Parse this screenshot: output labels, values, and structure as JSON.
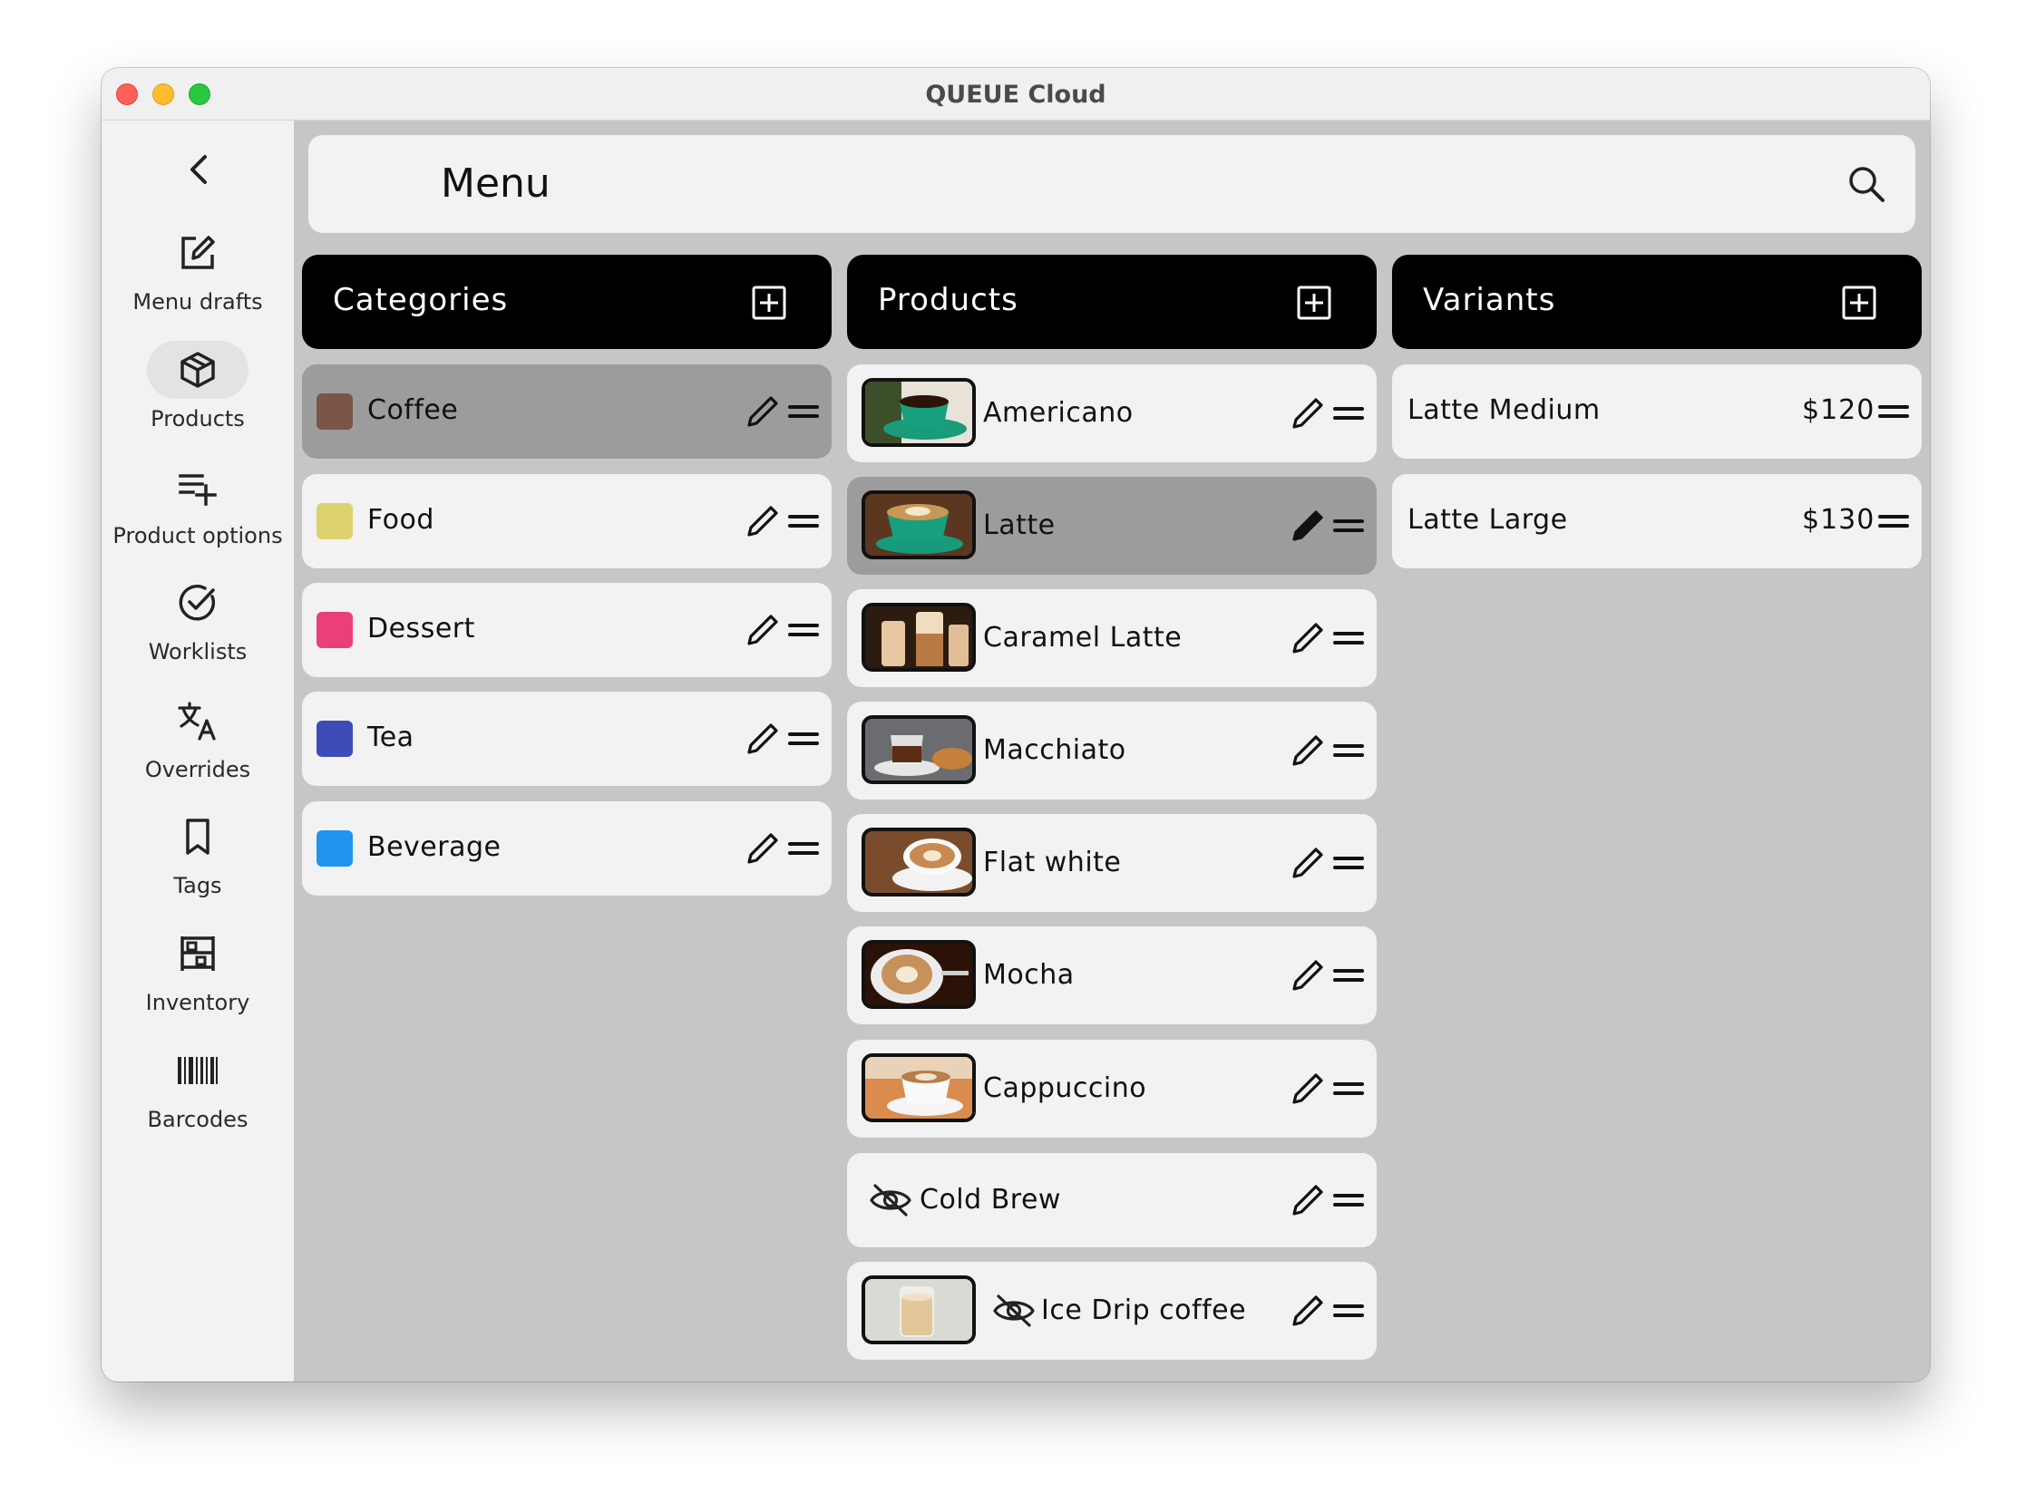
{
  "window": {
    "title": "QUEUE Cloud"
  },
  "sidebar": {
    "items": [
      {
        "label": "Menu drafts",
        "icon": "edit-square-icon"
      },
      {
        "label": "Products",
        "icon": "box-icon",
        "active": true
      },
      {
        "label": "Product options",
        "icon": "list-add-icon"
      },
      {
        "label": "Worklists",
        "icon": "check-circle-icon"
      },
      {
        "label": "Overrides",
        "icon": "translate-icon"
      },
      {
        "label": "Tags",
        "icon": "bookmark-icon"
      },
      {
        "label": "Inventory",
        "icon": "shelf-icon"
      },
      {
        "label": "Barcodes",
        "icon": "barcode-icon"
      }
    ]
  },
  "header": {
    "title": "Menu"
  },
  "columns": {
    "categories": {
      "title": "Categories",
      "items": [
        {
          "label": "Coffee",
          "color": "#7a5548",
          "selected": true
        },
        {
          "label": "Food",
          "color": "#dcd26e"
        },
        {
          "label": "Dessert",
          "color": "#ea3f7a"
        },
        {
          "label": "Tea",
          "color": "#3f4bb6"
        },
        {
          "label": "Beverage",
          "color": "#1f95f0"
        }
      ]
    },
    "products": {
      "title": "Products",
      "items": [
        {
          "label": "Americano",
          "has_image": true,
          "hidden": false
        },
        {
          "label": "Latte",
          "has_image": true,
          "hidden": false,
          "selected": true
        },
        {
          "label": "Caramel Latte",
          "has_image": true,
          "hidden": false
        },
        {
          "label": "Macchiato",
          "has_image": true,
          "hidden": false
        },
        {
          "label": "Flat white",
          "has_image": true,
          "hidden": false
        },
        {
          "label": "Mocha",
          "has_image": true,
          "hidden": false
        },
        {
          "label": "Cappuccino",
          "has_image": true,
          "hidden": false
        },
        {
          "label": "Cold Brew",
          "has_image": false,
          "hidden": true
        },
        {
          "label": "Ice Drip coffee",
          "has_image": true,
          "hidden": true
        }
      ]
    },
    "variants": {
      "title": "Variants",
      "items": [
        {
          "label": "Latte Medium",
          "price": "$120"
        },
        {
          "label": "Latte Large",
          "price": "$130"
        }
      ]
    }
  }
}
